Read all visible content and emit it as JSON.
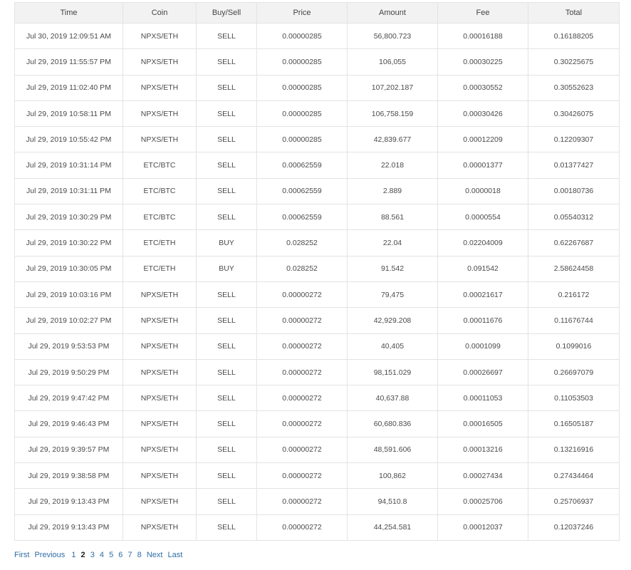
{
  "table": {
    "columns": [
      "Time",
      "Coin",
      "Buy/Sell",
      "Price",
      "Amount",
      "Fee",
      "Total"
    ],
    "rows": [
      [
        "Jul 30, 2019 12:09:51 AM",
        "NPXS/ETH",
        "SELL",
        "0.00000285",
        "56,800.723",
        "0.00016188",
        "0.16188205"
      ],
      [
        "Jul 29, 2019 11:55:57 PM",
        "NPXS/ETH",
        "SELL",
        "0.00000285",
        "106,055",
        "0.00030225",
        "0.30225675"
      ],
      [
        "Jul 29, 2019 11:02:40 PM",
        "NPXS/ETH",
        "SELL",
        "0.00000285",
        "107,202.187",
        "0.00030552",
        "0.30552623"
      ],
      [
        "Jul 29, 2019 10:58:11 PM",
        "NPXS/ETH",
        "SELL",
        "0.00000285",
        "106,758.159",
        "0.00030426",
        "0.30426075"
      ],
      [
        "Jul 29, 2019 10:55:42 PM",
        "NPXS/ETH",
        "SELL",
        "0.00000285",
        "42,839.677",
        "0.00012209",
        "0.12209307"
      ],
      [
        "Jul 29, 2019 10:31:14 PM",
        "ETC/BTC",
        "SELL",
        "0.00062559",
        "22.018",
        "0.00001377",
        "0.01377427"
      ],
      [
        "Jul 29, 2019 10:31:11 PM",
        "ETC/BTC",
        "SELL",
        "0.00062559",
        "2.889",
        "0.0000018",
        "0.00180736"
      ],
      [
        "Jul 29, 2019 10:30:29 PM",
        "ETC/BTC",
        "SELL",
        "0.00062559",
        "88.561",
        "0.0000554",
        "0.05540312"
      ],
      [
        "Jul 29, 2019 10:30:22 PM",
        "ETC/ETH",
        "BUY",
        "0.028252",
        "22.04",
        "0.02204009",
        "0.62267687"
      ],
      [
        "Jul 29, 2019 10:30:05 PM",
        "ETC/ETH",
        "BUY",
        "0.028252",
        "91.542",
        "0.091542",
        "2.58624458"
      ],
      [
        "Jul 29, 2019 10:03:16 PM",
        "NPXS/ETH",
        "SELL",
        "0.00000272",
        "79,475",
        "0.00021617",
        "0.216172"
      ],
      [
        "Jul 29, 2019 10:02:27 PM",
        "NPXS/ETH",
        "SELL",
        "0.00000272",
        "42,929.208",
        "0.00011676",
        "0.11676744"
      ],
      [
        "Jul 29, 2019 9:53:53 PM",
        "NPXS/ETH",
        "SELL",
        "0.00000272",
        "40,405",
        "0.0001099",
        "0.1099016"
      ],
      [
        "Jul 29, 2019 9:50:29 PM",
        "NPXS/ETH",
        "SELL",
        "0.00000272",
        "98,151.029",
        "0.00026697",
        "0.26697079"
      ],
      [
        "Jul 29, 2019 9:47:42 PM",
        "NPXS/ETH",
        "SELL",
        "0.00000272",
        "40,637.88",
        "0.00011053",
        "0.11053503"
      ],
      [
        "Jul 29, 2019 9:46:43 PM",
        "NPXS/ETH",
        "SELL",
        "0.00000272",
        "60,680.836",
        "0.00016505",
        "0.16505187"
      ],
      [
        "Jul 29, 2019 9:39:57 PM",
        "NPXS/ETH",
        "SELL",
        "0.00000272",
        "48,591.606",
        "0.00013216",
        "0.13216916"
      ],
      [
        "Jul 29, 2019 9:38:58 PM",
        "NPXS/ETH",
        "SELL",
        "0.00000272",
        "100,862",
        "0.00027434",
        "0.27434464"
      ],
      [
        "Jul 29, 2019 9:13:43 PM",
        "NPXS/ETH",
        "SELL",
        "0.00000272",
        "94,510.8",
        "0.00025706",
        "0.25706937"
      ],
      [
        "Jul 29, 2019 9:13:43 PM",
        "NPXS/ETH",
        "SELL",
        "0.00000272",
        "44,254.581",
        "0.00012037",
        "0.12037246"
      ]
    ]
  },
  "pagination": {
    "first": "First",
    "previous": "Previous",
    "pages": [
      "1",
      "2",
      "3",
      "4",
      "5",
      "6",
      "7",
      "8"
    ],
    "current": "2",
    "next": "Next",
    "last": "Last"
  },
  "colors": {
    "link": "#2e6da4",
    "header_bg": "#f2f2f2",
    "border": "#e3e3e3"
  }
}
